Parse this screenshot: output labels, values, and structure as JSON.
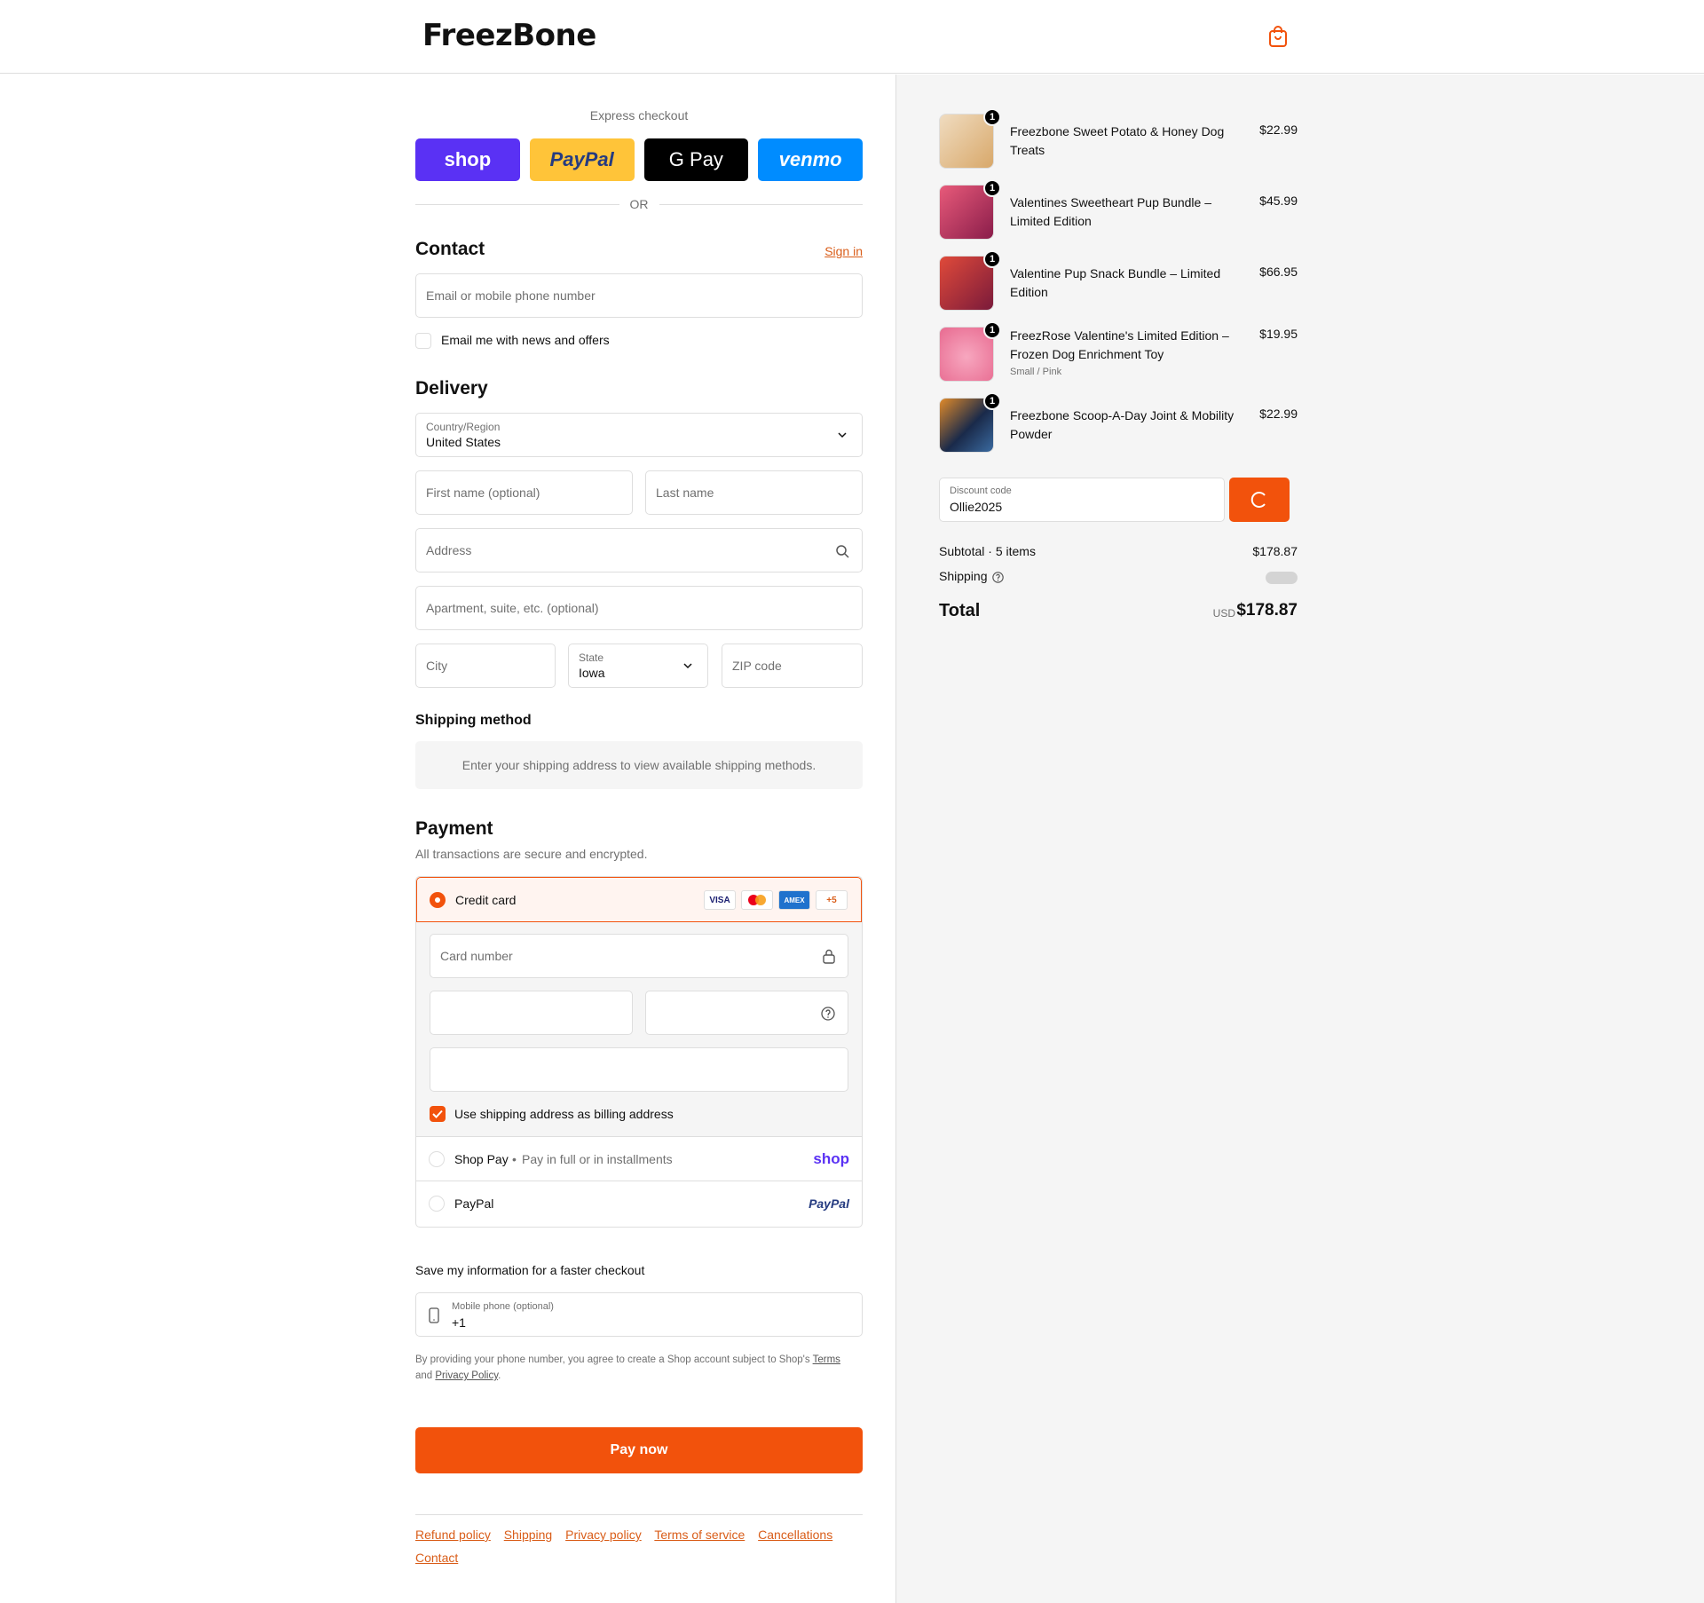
{
  "header": {
    "brand": "FreezBone",
    "cart_icon": "shopping-bag-icon"
  },
  "express": {
    "title": "Express checkout",
    "buttons": [
      {
        "label": "shop",
        "color": "#5a31f4"
      },
      {
        "label": "PayPal",
        "color": "#ffc439"
      },
      {
        "label": "G Pay",
        "color": "#000000"
      },
      {
        "label": "venmo",
        "color": "#008cff"
      }
    ],
    "or": "OR"
  },
  "contact": {
    "title": "Contact",
    "sign_in": "Sign in",
    "email_placeholder": "Email or mobile phone number",
    "news_label": "Email me with news and offers"
  },
  "delivery": {
    "title": "Delivery",
    "country_label": "Country/Region",
    "country_value": "United States",
    "first_name": "First name (optional)",
    "last_name": "Last name",
    "address": "Address",
    "apartment": "Apartment, suite, etc. (optional)",
    "city": "City",
    "state_label": "State",
    "state_value": "Iowa",
    "zip": "ZIP code"
  },
  "shipping_method": {
    "title": "Shipping method",
    "info": "Enter your shipping address to view available shipping methods."
  },
  "payment": {
    "title": "Payment",
    "subtitle": "All transactions are secure and encrypted.",
    "credit_card": "Credit card",
    "card_logos": [
      "VISA",
      "MC",
      "AMEX",
      "+5"
    ],
    "card_number": "Card number",
    "billing_label": "Use shipping address as billing address",
    "shop_pay": "Shop Pay",
    "shop_pay_desc": "Pay in full or in installments",
    "shop_pay_logo": "shop",
    "paypal": "PayPal",
    "paypal_logo": "PayPal"
  },
  "save_info": {
    "title": "Save my information for a faster checkout",
    "phone_label": "Mobile phone (optional)",
    "phone_value": "+1",
    "disclaimer_1": "By providing your phone number, you agree to create a Shop account subject to Shop's ",
    "terms": "Terms",
    "disclaimer_2": "and ",
    "privacy": "Privacy Policy",
    "disclaimer_3": "."
  },
  "pay_now": "Pay now",
  "footer": {
    "links": [
      "Refund policy",
      "Shipping",
      "Privacy policy",
      "Terms of service",
      "Cancellations",
      "Contact"
    ]
  },
  "cart": {
    "items": [
      {
        "name": "Freezbone Sweet Potato & Honey Dog Treats",
        "variant": "",
        "price": "$22.99",
        "qty": "1",
        "color": "#d8a86a"
      },
      {
        "name": "Valentines Sweetheart Pup Bundle – Limited Edition",
        "variant": "",
        "price": "$45.99",
        "qty": "1",
        "color": "#c8325a"
      },
      {
        "name": "Valentine Pup Snack Bundle – Limited Edition",
        "variant": "",
        "price": "$66.95",
        "qty": "1",
        "color": "#c8382a"
      },
      {
        "name": "FreezRose Valentine's Limited Edition – Frozen Dog Enrichment Toy",
        "variant": "Small / Pink",
        "price": "$19.95",
        "qty": "1",
        "color": "#f07fa0"
      },
      {
        "name": "Freezbone Scoop-A-Day Joint & Mobility Powder",
        "variant": "",
        "price": "$22.99",
        "qty": "1",
        "color": "#2a4a7a"
      }
    ],
    "discount_label": "Discount code",
    "discount_value": "Ollie2025",
    "subtotal_label": "Subtotal · 5 items",
    "subtotal_value": "$178.87",
    "shipping_label": "Shipping",
    "total_label": "Total",
    "currency": "USD",
    "total_value": "$178.87"
  }
}
